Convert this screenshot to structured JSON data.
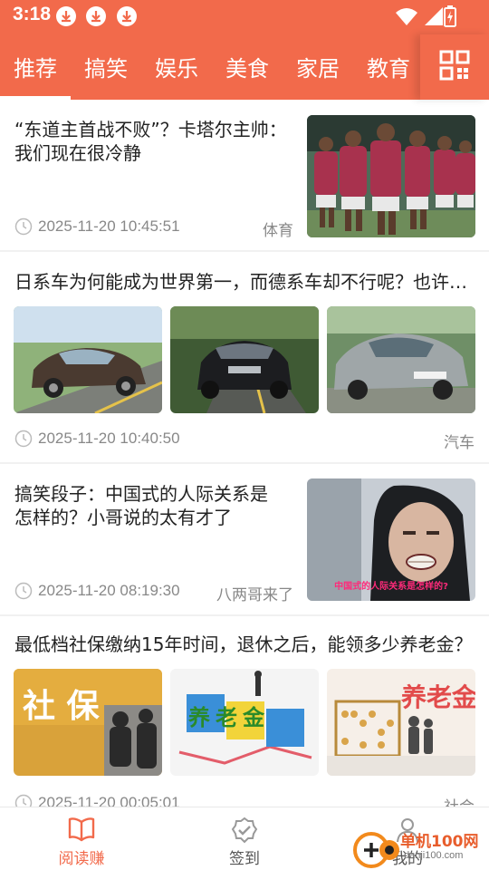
{
  "status_bar": {
    "time": "3:18",
    "notification_icons": [
      "download-icon",
      "download-icon",
      "download-icon"
    ],
    "system_icons": [
      "wifi-icon",
      "signal-icon",
      "battery-charging-icon"
    ]
  },
  "tabs": [
    {
      "label": "推荐",
      "active": true
    },
    {
      "label": "搞笑"
    },
    {
      "label": "娱乐"
    },
    {
      "label": "美食"
    },
    {
      "label": "家居"
    },
    {
      "label": "教育"
    }
  ],
  "grid_button_icon": "grid-menu-icon",
  "articles": [
    {
      "title_line1": "“东道主首战不败”？卡塔尔主帅：",
      "title_line2": "我们现在很冷静",
      "time": "2025-11-20 10:45:51",
      "category": "体育"
    },
    {
      "title": "日系车为何能成为世界第一，而德系车却不行呢？也许这几点是关键",
      "time": "2025-11-20 10:40:50",
      "category": "汽车"
    },
    {
      "title_line1": "搞笑段子：中国式的人际关系是",
      "title_line2": "怎样的？小哥说的太有才了",
      "time": "2025-11-20 08:19:30",
      "category": "八两哥来了",
      "image_caption": "中国式的人际关系是怎样的?"
    },
    {
      "title": "最低档社保缴纳15年时间，退休之后，能领多少养老金？",
      "time": "2025-11-20 00:05:01",
      "category": "社会",
      "image_texts": [
        "社 保",
        "养老金",
        "养老金"
      ]
    }
  ],
  "bottom_nav": [
    {
      "label": "阅读赚",
      "icon": "book-icon",
      "active": true
    },
    {
      "label": "签到",
      "icon": "checkin-icon"
    },
    {
      "label": "我的",
      "icon": "user-icon"
    }
  ],
  "watermark": {
    "text": "单机100网",
    "url": "danji100.com"
  },
  "colors": {
    "accent": "#f26a4b",
    "text": "#222222",
    "meta": "#888888"
  }
}
